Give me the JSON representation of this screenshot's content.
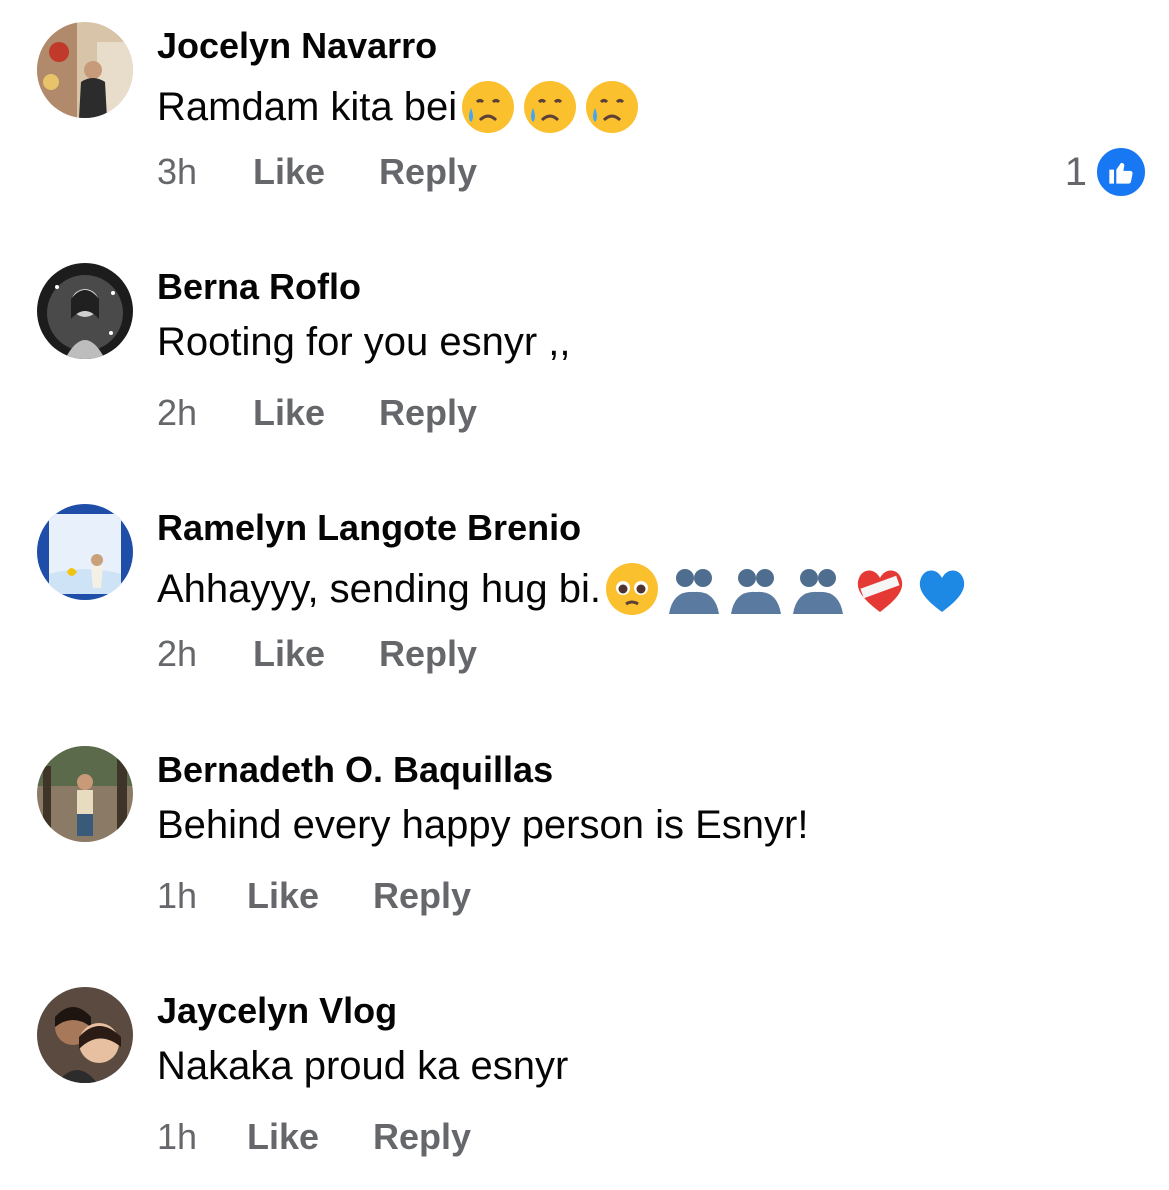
{
  "comments": [
    {
      "author": "Jocelyn Navarro",
      "text": "Ramdam kita bei",
      "emojis": [
        "sad-but-relieved-face",
        "sad-but-relieved-face",
        "sad-but-relieved-face"
      ],
      "time": "3h",
      "like_label": "Like",
      "reply_label": "Reply",
      "reaction_count": "1",
      "avatar_colors": [
        "#c9a07a",
        "#7a5a40",
        "#e8d8c0"
      ]
    },
    {
      "author": "Berna Roflo",
      "text": "Rooting for you esnyr ,,",
      "emojis": [],
      "time": "2h",
      "like_label": "Like",
      "reply_label": "Reply",
      "avatar_colors": [
        "#2a2a2a",
        "#9a9a9a",
        "#e0e0e0"
      ]
    },
    {
      "author": "Ramelyn Langote Brenio",
      "text": "Ahhayyy, sending hug bi.",
      "emojis": [
        "pleading-face",
        "people-hugging",
        "people-hugging",
        "people-hugging",
        "mending-heart",
        "blue-heart"
      ],
      "time": "2h",
      "like_label": "Like",
      "reply_label": "Reply",
      "avatar_colors": [
        "#1e4ea8",
        "#dce9f7",
        "#f0ead8"
      ]
    },
    {
      "author": "Bernadeth O. Baquillas",
      "text": "Behind every happy person is Esnyr!",
      "emojis": [],
      "time": "1h",
      "like_label": "Like",
      "reply_label": "Reply",
      "avatar_colors": [
        "#7a6a58",
        "#a89678",
        "#3a4a5a"
      ]
    },
    {
      "author": "Jaycelyn Vlog",
      "text": "Nakaka proud ka esnyr",
      "emojis": [],
      "time": "1h",
      "like_label": "Like",
      "reply_label": "Reply",
      "avatar_colors": [
        "#3a2a22",
        "#c8906a",
        "#e6c0a0"
      ]
    }
  ],
  "colors": {
    "meta_text": "#65676b",
    "like_blue": "#1877f2"
  }
}
